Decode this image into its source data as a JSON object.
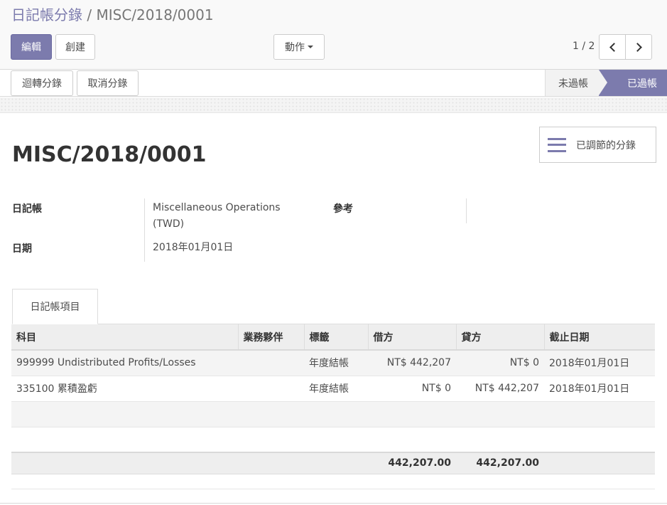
{
  "breadcrumb": {
    "parent": "日記帳分錄",
    "separator": "/",
    "current": "MISC/2018/0001"
  },
  "control_panel": {
    "edit_label": "編輯",
    "create_label": "創建",
    "action_label": "動作",
    "pager_value": "1 / 2"
  },
  "header": {
    "reverse_label": "迴轉分錄",
    "cancel_label": "取消分錄",
    "status_draft": "未過帳",
    "status_posted": "已過帳",
    "active_status": "已過帳"
  },
  "smart_button": {
    "label": "已調節的分錄",
    "icon": "bars-icon"
  },
  "record": {
    "name": "MISC/2018/0001",
    "journal_label": "日記帳",
    "journal_value_line1": "Miscellaneous Operations",
    "journal_value_line2": "(TWD)",
    "date_label": "日期",
    "date_value": "2018年01月01日",
    "ref_label": "參考",
    "ref_value": ""
  },
  "notebook": {
    "tab_label": "日記帳項目"
  },
  "lines": {
    "headers": [
      "科目",
      "業務夥伴",
      "標籤",
      "借方",
      "貸方",
      "截止日期"
    ],
    "rows": [
      {
        "account": "999999 Undistributed Profits/Losses",
        "partner": "",
        "label": "年度結帳",
        "debit": "NT$ 442,207",
        "credit": "NT$ 0",
        "maturity": "2018年01月01日"
      },
      {
        "account": "335100 累積盈虧",
        "partner": "",
        "label": "年度結帳",
        "debit": "NT$ 0",
        "credit": "NT$ 442,207",
        "maturity": "2018年01月01日"
      }
    ],
    "total_debit": "442,207.00",
    "total_credit": "442,207.00"
  },
  "colors": {
    "accent": "#7c7bad",
    "header_bg": "#eeeeee"
  }
}
